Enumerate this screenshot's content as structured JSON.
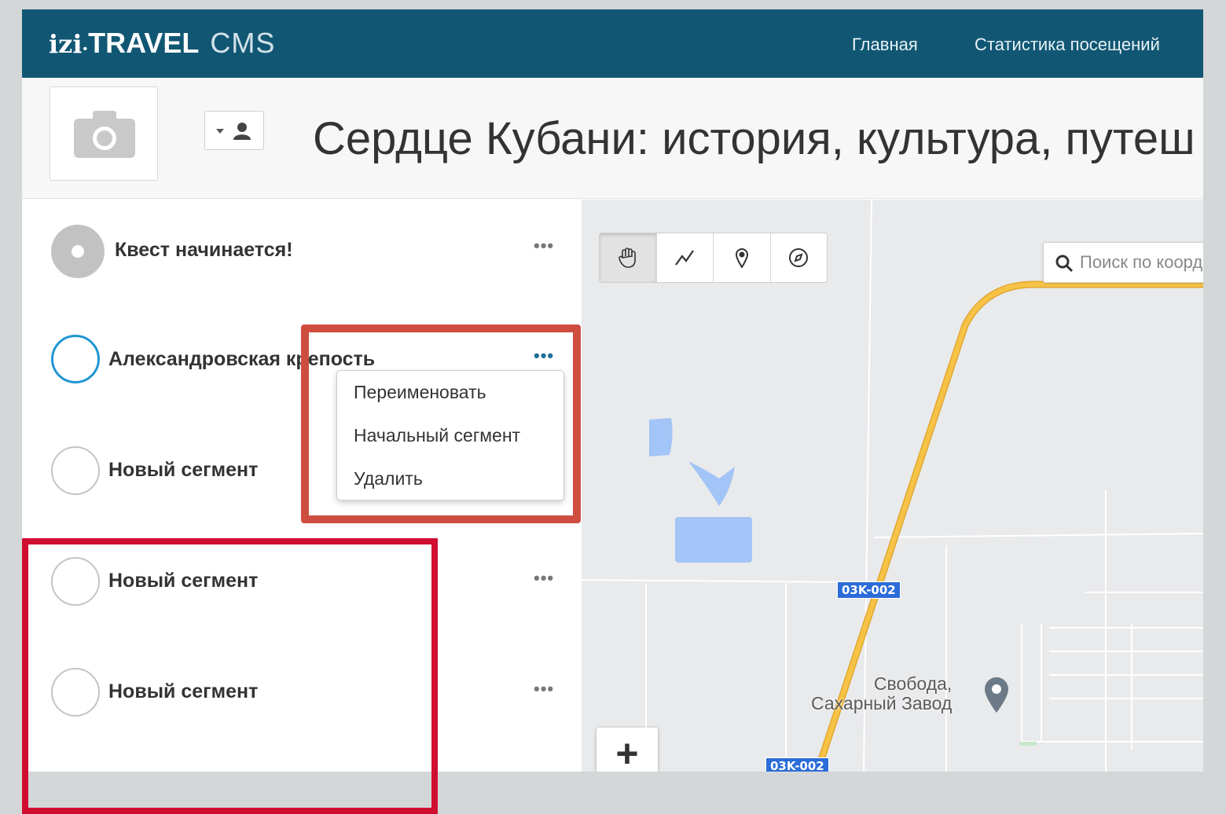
{
  "app": {
    "logo_izi": "izi",
    "logo_dot": "•",
    "logo_travel": "TRAVEL",
    "logo_cms": "CMS"
  },
  "nav": {
    "home": "Главная",
    "stats": "Статистика посещений"
  },
  "header": {
    "title": "Сердце Кубани: история, культура, путеш"
  },
  "segments": [
    {
      "label": "Квест начинается!",
      "state": "start"
    },
    {
      "label": "Александровская крепость",
      "state": "active"
    },
    {
      "label": "Новый сегмент",
      "state": "normal"
    },
    {
      "label": "Новый сегмент",
      "state": "normal"
    },
    {
      "label": "Новый сегмент",
      "state": "normal"
    }
  ],
  "more_glyph": "•••",
  "context_menu": {
    "rename": "Переименовать",
    "start_segment": "Начальный сегмент",
    "delete": "Удалить"
  },
  "map": {
    "tools": [
      "hand-icon",
      "route-icon",
      "marker-icon",
      "compass-icon"
    ],
    "search_placeholder": "Поиск по координатам",
    "zoom_in": "+",
    "road_label": "03K-002",
    "place_line1": "Свобода,",
    "place_line2": "Сахарный Завод"
  },
  "colors": {
    "topbar": "#115774",
    "active_segment": "#2196d3",
    "highlight_menu": "#cf4d3f",
    "highlight_list": "#d00e30",
    "road": "#f7c347"
  }
}
